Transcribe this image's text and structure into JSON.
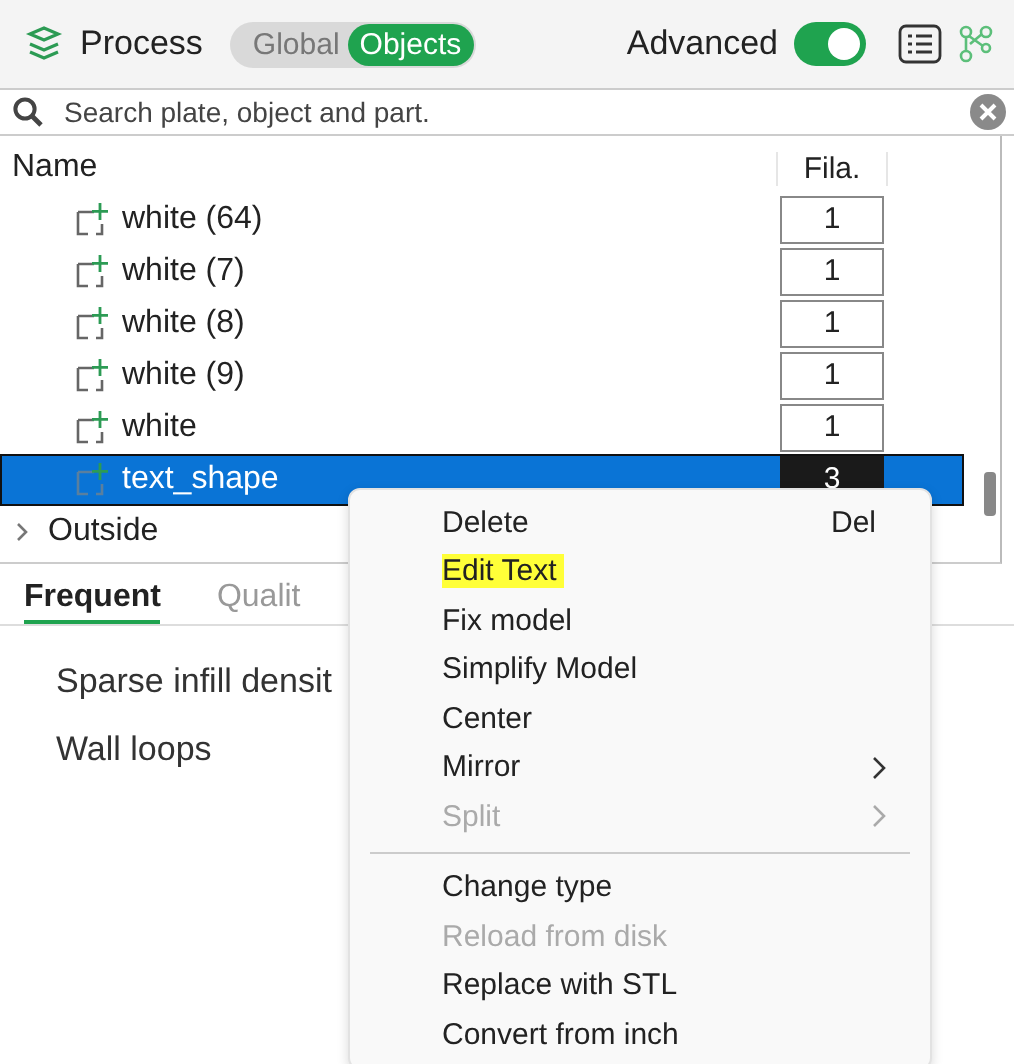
{
  "header": {
    "title": "Process",
    "modes": [
      {
        "label": "Global",
        "selected": false
      },
      {
        "label": "Objects",
        "selected": true
      }
    ],
    "advanced": {
      "label": "Advanced",
      "on": true
    }
  },
  "search": {
    "placeholder": "Search plate, object and part."
  },
  "table": {
    "columns": [
      "Name",
      "Fila."
    ],
    "rows": [
      {
        "name": "white (64)",
        "filament": "1",
        "selected": false
      },
      {
        "name": "white (7)",
        "filament": "1",
        "selected": false
      },
      {
        "name": "white (8)",
        "filament": "1",
        "selected": false
      },
      {
        "name": "white (9)",
        "filament": "1",
        "selected": false
      },
      {
        "name": "white",
        "filament": "1",
        "selected": false
      },
      {
        "name": "text_shape",
        "filament": "3",
        "selected": true
      }
    ],
    "groups": [
      {
        "label": "Outside",
        "expanded": false
      }
    ]
  },
  "tabs": [
    {
      "label": "Frequent",
      "selected": true
    },
    {
      "label": "Qualit",
      "selected": false
    }
  ],
  "params": [
    "Sparse infill densit",
    "Wall loops"
  ],
  "context_menu": [
    {
      "label": "Delete",
      "shortcut": "Del",
      "disabled": false,
      "highlighted": false,
      "submenu": false
    },
    {
      "label": "Edit Text",
      "disabled": false,
      "highlighted": true,
      "submenu": false
    },
    {
      "label": "Fix model",
      "disabled": false,
      "highlighted": false,
      "submenu": false
    },
    {
      "label": "Simplify Model",
      "disabled": false,
      "highlighted": false,
      "submenu": false
    },
    {
      "label": "Center",
      "disabled": false,
      "highlighted": false,
      "submenu": false
    },
    {
      "label": "Mirror",
      "disabled": false,
      "highlighted": false,
      "submenu": true
    },
    {
      "label": "Split",
      "disabled": true,
      "highlighted": false,
      "submenu": true,
      "separator_after": true
    },
    {
      "label": "Change type",
      "disabled": false,
      "highlighted": false,
      "submenu": false
    },
    {
      "label": "Reload from disk",
      "disabled": true,
      "highlighted": false,
      "submenu": false
    },
    {
      "label": "Replace with STL",
      "disabled": false,
      "highlighted": false,
      "submenu": false
    },
    {
      "label": "Convert from inch",
      "disabled": false,
      "highlighted": false,
      "submenu": false
    }
  ]
}
